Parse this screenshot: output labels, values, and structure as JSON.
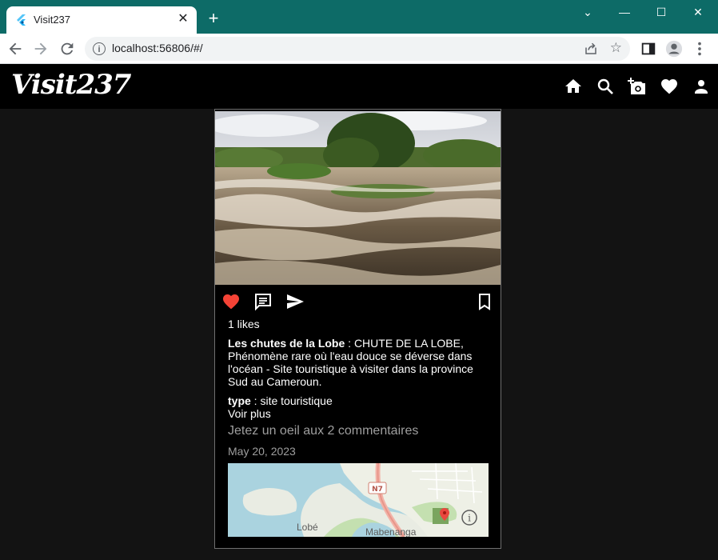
{
  "browser": {
    "tab_title": "Visit237",
    "tab_close": "✕",
    "new_tab": "+",
    "url": "localhost:56806/#/",
    "controls": {
      "dropdown": "⌄",
      "minimize": "—",
      "maximize": "☐",
      "close": "✕"
    }
  },
  "app": {
    "logo": "Visit237",
    "nav_icons": [
      "home-icon",
      "search-icon",
      "add-photo-icon",
      "heart-icon",
      "person-icon"
    ]
  },
  "post": {
    "likes": "1 likes",
    "title": "Les chutes de la Lobe",
    "separator": " : ",
    "description": "CHUTE DE LA LOBE, Phénomène rare où l'eau douce se déverse dans l'océan - Site touristique à visiter dans la province Sud au Cameroun.",
    "type_label": "type",
    "type_value": "site touristique",
    "see_more": "Voir plus",
    "comments": "Jetez un oeil aux 2 commentaires",
    "date": "May 20, 2023",
    "liked": true
  },
  "map": {
    "road_label": "N7",
    "place_1": "Lobé",
    "place_2": "Mabenanga",
    "info": "i"
  },
  "colors": {
    "tabbar": "#0d6b67",
    "like_red": "#f44336",
    "appbar": "#000000",
    "background": "#131313"
  }
}
